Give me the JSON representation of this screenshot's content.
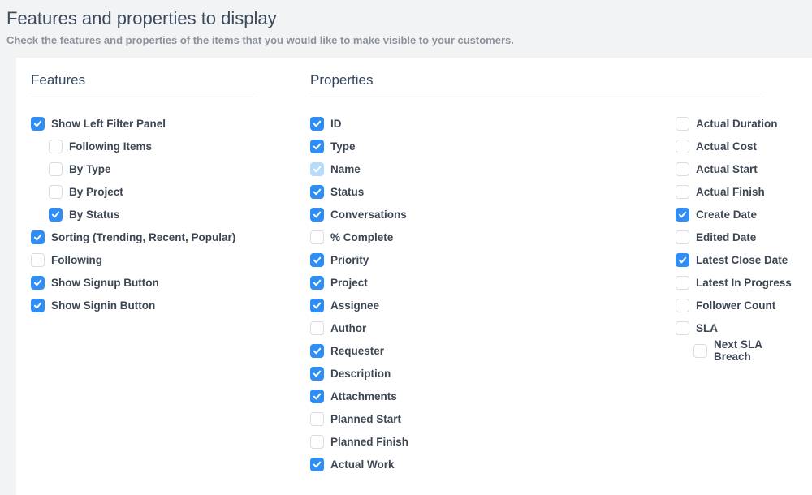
{
  "header": {
    "title": "Features and properties to display",
    "subtitle": "Check the features and properties of the items that you would like to make visible to your customers."
  },
  "sections": {
    "features_title": "Features",
    "properties_title": "Properties"
  },
  "features": [
    {
      "label": "Show Left Filter Panel",
      "checked": true,
      "indent": 0
    },
    {
      "label": "Following Items",
      "checked": false,
      "indent": 1
    },
    {
      "label": "By Type",
      "checked": false,
      "indent": 1
    },
    {
      "label": "By Project",
      "checked": false,
      "indent": 1
    },
    {
      "label": "By Status",
      "checked": true,
      "indent": 1
    },
    {
      "label": "Sorting (Trending, Recent, Popular)",
      "checked": true,
      "indent": 0
    },
    {
      "label": "Following",
      "checked": false,
      "indent": 0
    },
    {
      "label": "Show Signup Button",
      "checked": true,
      "indent": 0
    },
    {
      "label": "Show Signin Button",
      "checked": true,
      "indent": 0
    }
  ],
  "properties_left": [
    {
      "label": "ID",
      "checked": true
    },
    {
      "label": "Type",
      "checked": true
    },
    {
      "label": "Name",
      "checked": true,
      "light": true
    },
    {
      "label": "Status",
      "checked": true
    },
    {
      "label": "Conversations",
      "checked": true
    },
    {
      "label": "% Complete",
      "checked": false
    },
    {
      "label": "Priority",
      "checked": true
    },
    {
      "label": "Project",
      "checked": true
    },
    {
      "label": "Assignee",
      "checked": true
    },
    {
      "label": "Author",
      "checked": false
    },
    {
      "label": "Requester",
      "checked": true
    },
    {
      "label": "Description",
      "checked": true
    },
    {
      "label": "Attachments",
      "checked": true
    },
    {
      "label": "Planned Start",
      "checked": false
    },
    {
      "label": "Planned Finish",
      "checked": false
    },
    {
      "label": "Actual Work",
      "checked": true
    }
  ],
  "properties_right": [
    {
      "label": "Actual Duration",
      "checked": false,
      "indent": 0
    },
    {
      "label": "Actual Cost",
      "checked": false,
      "indent": 0
    },
    {
      "label": "Actual Start",
      "checked": false,
      "indent": 0
    },
    {
      "label": "Actual Finish",
      "checked": false,
      "indent": 0
    },
    {
      "label": "Create Date",
      "checked": true,
      "indent": 0
    },
    {
      "label": "Edited Date",
      "checked": false,
      "indent": 0
    },
    {
      "label": "Latest Close Date",
      "checked": true,
      "indent": 0
    },
    {
      "label": "Latest In Progress",
      "checked": false,
      "indent": 0
    },
    {
      "label": "Follower Count",
      "checked": false,
      "indent": 0
    },
    {
      "label": "SLA",
      "checked": false,
      "indent": 0
    },
    {
      "label": "Next SLA Breach",
      "checked": false,
      "indent": 1
    }
  ]
}
